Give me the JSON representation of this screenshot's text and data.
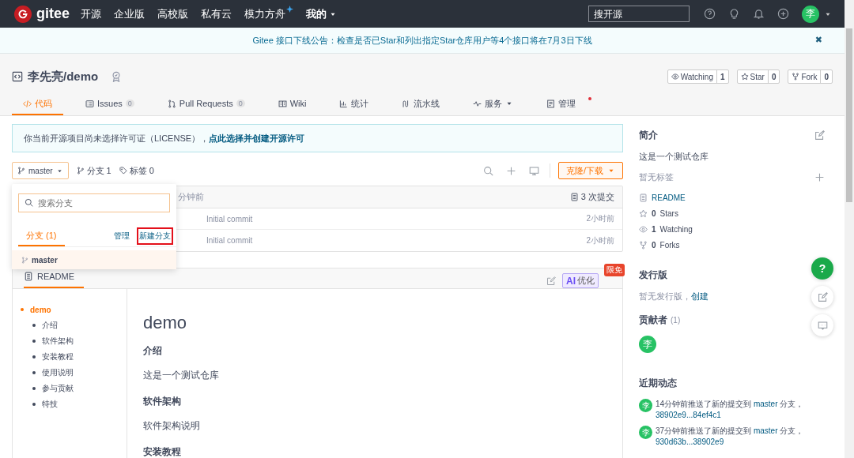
{
  "navbar": {
    "logo": "gitee",
    "menu": [
      {
        "label": "开源",
        "kind": "plain"
      },
      {
        "label": "企业版",
        "kind": "plain"
      },
      {
        "label": "高校版",
        "kind": "plain"
      },
      {
        "label": "私有云",
        "kind": "plain"
      },
      {
        "label": "模力方舟",
        "kind": "sparkle"
      },
      {
        "label": "我的",
        "kind": "dropdown"
      }
    ],
    "search": {
      "placeholder": "搜开源"
    },
    "avatar": "李"
  },
  "notice": {
    "text": "Gitee 接口下线公告：检查是否已Star和列出指定Star仓库用户等4个接口将在7月3日下线",
    "close": "✖"
  },
  "repo": {
    "title": "李先亮/demo",
    "actions": [
      {
        "label": "Watching",
        "count": "1",
        "kind": "eye"
      },
      {
        "label": "Star",
        "count": "0",
        "kind": "star"
      },
      {
        "label": "Fork",
        "count": "0",
        "kind": "fork"
      }
    ]
  },
  "tabs": [
    {
      "label": "代码",
      "selected": true
    },
    {
      "label": "Issues",
      "count": "0",
      "selected": false
    },
    {
      "label": "Pull Requests",
      "count": "0",
      "selected": false
    },
    {
      "label": "Wiki",
      "selected": false
    },
    {
      "label": "统计",
      "selected": false
    },
    {
      "label": "流水线",
      "selected": false
    },
    {
      "label": "服务",
      "dropdown": true,
      "selected": false
    },
    {
      "label": "管理",
      "dot": true,
      "selected": false
    }
  ],
  "license_notice": {
    "text": "你当前开源项目尚未选择许可证（LICENSE），",
    "link": "点此选择并创建开源许可"
  },
  "branch_bar": {
    "branch": "master",
    "branches": "分支 1",
    "tags": "标签 0",
    "clone": "克隆/下载"
  },
  "branch_dropdown": {
    "placeholder": "搜索分支",
    "tab": "分支 (1)",
    "links": [
      {
        "label": "管理",
        "highlighted": false
      },
      {
        "label": "新建分支",
        "highlighted": true
      }
    ],
    "items": [
      {
        "name": "master",
        "selected": true
      }
    ]
  },
  "files": {
    "header_time": "分钟前",
    "commits": "3 次提交",
    "rows": [
      {
        "message": "Initial commit",
        "time": "2小时前"
      },
      {
        "message": "Initial commit",
        "time": "2小时前"
      }
    ]
  },
  "readme": {
    "tab": "README",
    "badge": "限免",
    "ai_button": {
      "mark": "AI",
      "label": "优化"
    },
    "toc": [
      {
        "label": "demo",
        "selected": true,
        "children": [
          {
            "label": "介绍",
            "selected": false
          },
          {
            "label": "软件架构",
            "selected": false
          },
          {
            "label": "安装教程",
            "selected": false
          },
          {
            "label": "使用说明",
            "selected": false
          },
          {
            "label": "参与贡献",
            "selected": false
          },
          {
            "label": "特技",
            "selected": false
          }
        ]
      }
    ],
    "title": "demo",
    "sections": [
      {
        "heading": "介绍",
        "text": "这是一个测试仓库"
      },
      {
        "heading": "软件架构",
        "text": "软件架构说明"
      },
      {
        "heading": "安装教程"
      }
    ]
  },
  "sidebar": {
    "about_heading": "简介",
    "description": "这是一个测试仓库",
    "no_tags": "暂无标签",
    "stats": [
      {
        "kind": "readme",
        "label": "README"
      },
      {
        "kind": "star",
        "count": "0",
        "label": "Stars"
      },
      {
        "kind": "eye",
        "count": "1",
        "label": "Watching"
      },
      {
        "kind": "fork",
        "count": "0",
        "label": "Forks"
      }
    ],
    "releases_heading": "发行版",
    "no_releases": "暂无发行版，",
    "create_link": "创建",
    "contributors_heading": "贡献者",
    "contributors_count": "(1)",
    "contributors": [
      "李"
    ],
    "activity_heading": "近期动态",
    "activity": [
      {
        "avatar": "李",
        "text": "14分钟前推送了新的提交到",
        "branch": "master",
        "suffix": "分支，",
        "commit": "38902e9...84ef4c1"
      },
      {
        "avatar": "李",
        "text": "37分钟前推送了新的提交到",
        "branch": "master",
        "suffix": "分支，",
        "commit": "930d63b...38902e9"
      }
    ]
  },
  "float_buttons": [
    {
      "kind": "help",
      "label": "?"
    },
    {
      "kind": "edit"
    },
    {
      "kind": "comment"
    }
  ]
}
